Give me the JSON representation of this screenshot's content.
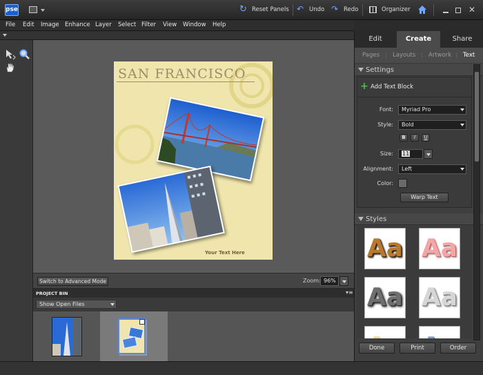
{
  "app": {
    "logo": "pse"
  },
  "toolbar": {
    "reset_panels": "Reset Panels",
    "undo": "Undo",
    "redo": "Redo",
    "organizer": "Organizer"
  },
  "menu": [
    "File",
    "Edit",
    "Image",
    "Enhance",
    "Layer",
    "Select",
    "Filter",
    "View",
    "Window",
    "Help"
  ],
  "canvas": {
    "title": "SAN FRANCISCO",
    "footer_text": "Your Text Here"
  },
  "status": {
    "switch_mode": "Switch to Advanced Mode",
    "zoom_label": "Zoom:",
    "zoom_value": "96%"
  },
  "project_bin": {
    "header": "PROJECT BIN",
    "filter": "Show Open Files"
  },
  "panel": {
    "tabs": [
      "Edit",
      "Create",
      "Share"
    ],
    "active_tab": "Create",
    "subtabs": [
      "Pages",
      "Layouts",
      "Artwork",
      "Text"
    ],
    "active_subtab": "Text",
    "settings_title": "Settings",
    "add_text_block": "Add Text Block",
    "font_label": "Font:",
    "font_value": "Myriad Pro",
    "style_label": "Style:",
    "style_value": "Bold",
    "bold": "B",
    "italic": "I",
    "underline": "U",
    "size_label": "Size:",
    "size_value": "11",
    "alignment_label": "Alignment:",
    "alignment_value": "Left",
    "color_label": "Color:",
    "warp_text": "Warp Text",
    "styles_title": "Styles",
    "style_sample": "Aa",
    "done": "Done",
    "print": "Print",
    "order": "Order"
  },
  "colors": {
    "panel_bg": "#3f3f3f",
    "canvas_bg": "#5a5a5a",
    "page_bg": "#f0e6ad",
    "accent_blue": "#2b6fd6",
    "add_plus": "#48c048"
  }
}
